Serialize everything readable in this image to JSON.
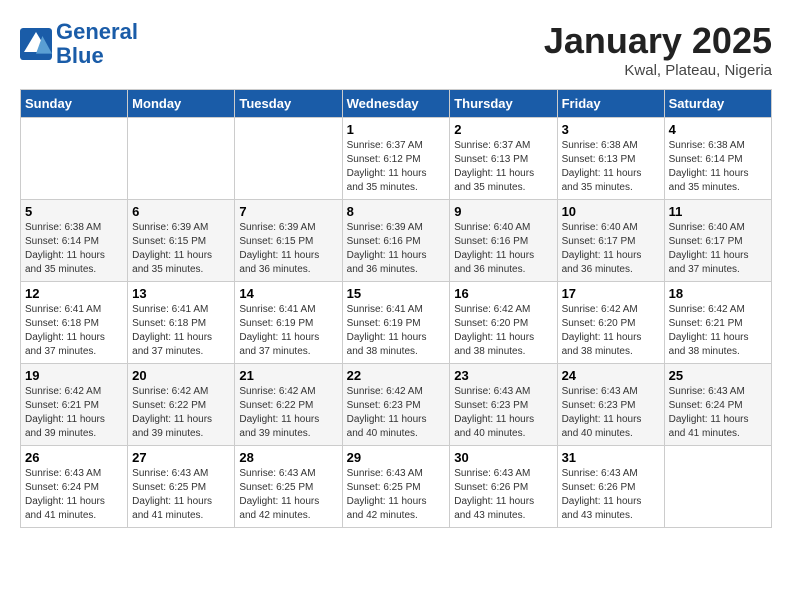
{
  "logo": {
    "line1": "General",
    "line2": "Blue"
  },
  "title": "January 2025",
  "subtitle": "Kwal, Plateau, Nigeria",
  "weekdays": [
    "Sunday",
    "Monday",
    "Tuesday",
    "Wednesday",
    "Thursday",
    "Friday",
    "Saturday"
  ],
  "weeks": [
    [
      {
        "day": "",
        "sunrise": "",
        "sunset": "",
        "daylight": ""
      },
      {
        "day": "",
        "sunrise": "",
        "sunset": "",
        "daylight": ""
      },
      {
        "day": "",
        "sunrise": "",
        "sunset": "",
        "daylight": ""
      },
      {
        "day": "1",
        "sunrise": "Sunrise: 6:37 AM",
        "sunset": "Sunset: 6:12 PM",
        "daylight": "Daylight: 11 hours and 35 minutes."
      },
      {
        "day": "2",
        "sunrise": "Sunrise: 6:37 AM",
        "sunset": "Sunset: 6:13 PM",
        "daylight": "Daylight: 11 hours and 35 minutes."
      },
      {
        "day": "3",
        "sunrise": "Sunrise: 6:38 AM",
        "sunset": "Sunset: 6:13 PM",
        "daylight": "Daylight: 11 hours and 35 minutes."
      },
      {
        "day": "4",
        "sunrise": "Sunrise: 6:38 AM",
        "sunset": "Sunset: 6:14 PM",
        "daylight": "Daylight: 11 hours and 35 minutes."
      }
    ],
    [
      {
        "day": "5",
        "sunrise": "Sunrise: 6:38 AM",
        "sunset": "Sunset: 6:14 PM",
        "daylight": "Daylight: 11 hours and 35 minutes."
      },
      {
        "day": "6",
        "sunrise": "Sunrise: 6:39 AM",
        "sunset": "Sunset: 6:15 PM",
        "daylight": "Daylight: 11 hours and 35 minutes."
      },
      {
        "day": "7",
        "sunrise": "Sunrise: 6:39 AM",
        "sunset": "Sunset: 6:15 PM",
        "daylight": "Daylight: 11 hours and 36 minutes."
      },
      {
        "day": "8",
        "sunrise": "Sunrise: 6:39 AM",
        "sunset": "Sunset: 6:16 PM",
        "daylight": "Daylight: 11 hours and 36 minutes."
      },
      {
        "day": "9",
        "sunrise": "Sunrise: 6:40 AM",
        "sunset": "Sunset: 6:16 PM",
        "daylight": "Daylight: 11 hours and 36 minutes."
      },
      {
        "day": "10",
        "sunrise": "Sunrise: 6:40 AM",
        "sunset": "Sunset: 6:17 PM",
        "daylight": "Daylight: 11 hours and 36 minutes."
      },
      {
        "day": "11",
        "sunrise": "Sunrise: 6:40 AM",
        "sunset": "Sunset: 6:17 PM",
        "daylight": "Daylight: 11 hours and 37 minutes."
      }
    ],
    [
      {
        "day": "12",
        "sunrise": "Sunrise: 6:41 AM",
        "sunset": "Sunset: 6:18 PM",
        "daylight": "Daylight: 11 hours and 37 minutes."
      },
      {
        "day": "13",
        "sunrise": "Sunrise: 6:41 AM",
        "sunset": "Sunset: 6:18 PM",
        "daylight": "Daylight: 11 hours and 37 minutes."
      },
      {
        "day": "14",
        "sunrise": "Sunrise: 6:41 AM",
        "sunset": "Sunset: 6:19 PM",
        "daylight": "Daylight: 11 hours and 37 minutes."
      },
      {
        "day": "15",
        "sunrise": "Sunrise: 6:41 AM",
        "sunset": "Sunset: 6:19 PM",
        "daylight": "Daylight: 11 hours and 38 minutes."
      },
      {
        "day": "16",
        "sunrise": "Sunrise: 6:42 AM",
        "sunset": "Sunset: 6:20 PM",
        "daylight": "Daylight: 11 hours and 38 minutes."
      },
      {
        "day": "17",
        "sunrise": "Sunrise: 6:42 AM",
        "sunset": "Sunset: 6:20 PM",
        "daylight": "Daylight: 11 hours and 38 minutes."
      },
      {
        "day": "18",
        "sunrise": "Sunrise: 6:42 AM",
        "sunset": "Sunset: 6:21 PM",
        "daylight": "Daylight: 11 hours and 38 minutes."
      }
    ],
    [
      {
        "day": "19",
        "sunrise": "Sunrise: 6:42 AM",
        "sunset": "Sunset: 6:21 PM",
        "daylight": "Daylight: 11 hours and 39 minutes."
      },
      {
        "day": "20",
        "sunrise": "Sunrise: 6:42 AM",
        "sunset": "Sunset: 6:22 PM",
        "daylight": "Daylight: 11 hours and 39 minutes."
      },
      {
        "day": "21",
        "sunrise": "Sunrise: 6:42 AM",
        "sunset": "Sunset: 6:22 PM",
        "daylight": "Daylight: 11 hours and 39 minutes."
      },
      {
        "day": "22",
        "sunrise": "Sunrise: 6:42 AM",
        "sunset": "Sunset: 6:23 PM",
        "daylight": "Daylight: 11 hours and 40 minutes."
      },
      {
        "day": "23",
        "sunrise": "Sunrise: 6:43 AM",
        "sunset": "Sunset: 6:23 PM",
        "daylight": "Daylight: 11 hours and 40 minutes."
      },
      {
        "day": "24",
        "sunrise": "Sunrise: 6:43 AM",
        "sunset": "Sunset: 6:23 PM",
        "daylight": "Daylight: 11 hours and 40 minutes."
      },
      {
        "day": "25",
        "sunrise": "Sunrise: 6:43 AM",
        "sunset": "Sunset: 6:24 PM",
        "daylight": "Daylight: 11 hours and 41 minutes."
      }
    ],
    [
      {
        "day": "26",
        "sunrise": "Sunrise: 6:43 AM",
        "sunset": "Sunset: 6:24 PM",
        "daylight": "Daylight: 11 hours and 41 minutes."
      },
      {
        "day": "27",
        "sunrise": "Sunrise: 6:43 AM",
        "sunset": "Sunset: 6:25 PM",
        "daylight": "Daylight: 11 hours and 41 minutes."
      },
      {
        "day": "28",
        "sunrise": "Sunrise: 6:43 AM",
        "sunset": "Sunset: 6:25 PM",
        "daylight": "Daylight: 11 hours and 42 minutes."
      },
      {
        "day": "29",
        "sunrise": "Sunrise: 6:43 AM",
        "sunset": "Sunset: 6:25 PM",
        "daylight": "Daylight: 11 hours and 42 minutes."
      },
      {
        "day": "30",
        "sunrise": "Sunrise: 6:43 AM",
        "sunset": "Sunset: 6:26 PM",
        "daylight": "Daylight: 11 hours and 43 minutes."
      },
      {
        "day": "31",
        "sunrise": "Sunrise: 6:43 AM",
        "sunset": "Sunset: 6:26 PM",
        "daylight": "Daylight: 11 hours and 43 minutes."
      },
      {
        "day": "",
        "sunrise": "",
        "sunset": "",
        "daylight": ""
      }
    ]
  ]
}
